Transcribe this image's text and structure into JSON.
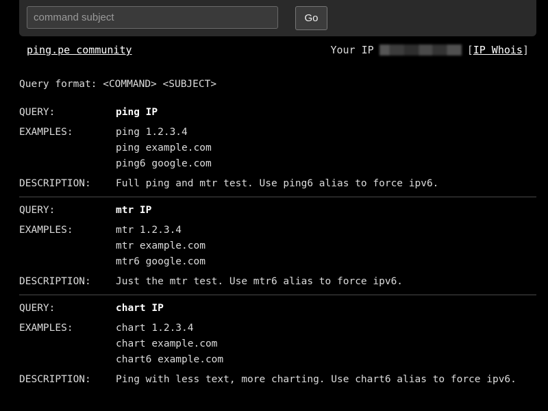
{
  "search": {
    "placeholder": "command subject",
    "value": "",
    "button_label": "Go"
  },
  "infobar": {
    "community_link": "ping.pe community",
    "your_ip_label": "Your IP",
    "whois_open": "[",
    "whois_link": "IP Whois",
    "whois_close": "]"
  },
  "format_line": "Query format: <COMMAND> <SUBJECT>",
  "labels": {
    "query": "QUERY:",
    "examples": "EXAMPLES:",
    "description": "DESCRIPTION:"
  },
  "entries": [
    {
      "query": "ping IP",
      "examples": [
        "ping 1.2.3.4",
        "ping example.com",
        "ping6 google.com"
      ],
      "description": "Full ping and mtr test. Use ping6 alias to force ipv6."
    },
    {
      "query": "mtr IP",
      "examples": [
        "mtr 1.2.3.4",
        "mtr example.com",
        "mtr6 google.com"
      ],
      "description": "Just the mtr test. Use mtr6 alias to force ipv6."
    },
    {
      "query": "chart IP",
      "examples": [
        "chart 1.2.3.4",
        "chart example.com",
        "chart6 example.com"
      ],
      "description": "Ping with less text, more charting. Use chart6 alias to force ipv6."
    }
  ],
  "colors": {
    "background": "#000000",
    "topbar": "#2a2a2a",
    "text": "#dcdcdc",
    "link": "#ffffff"
  }
}
